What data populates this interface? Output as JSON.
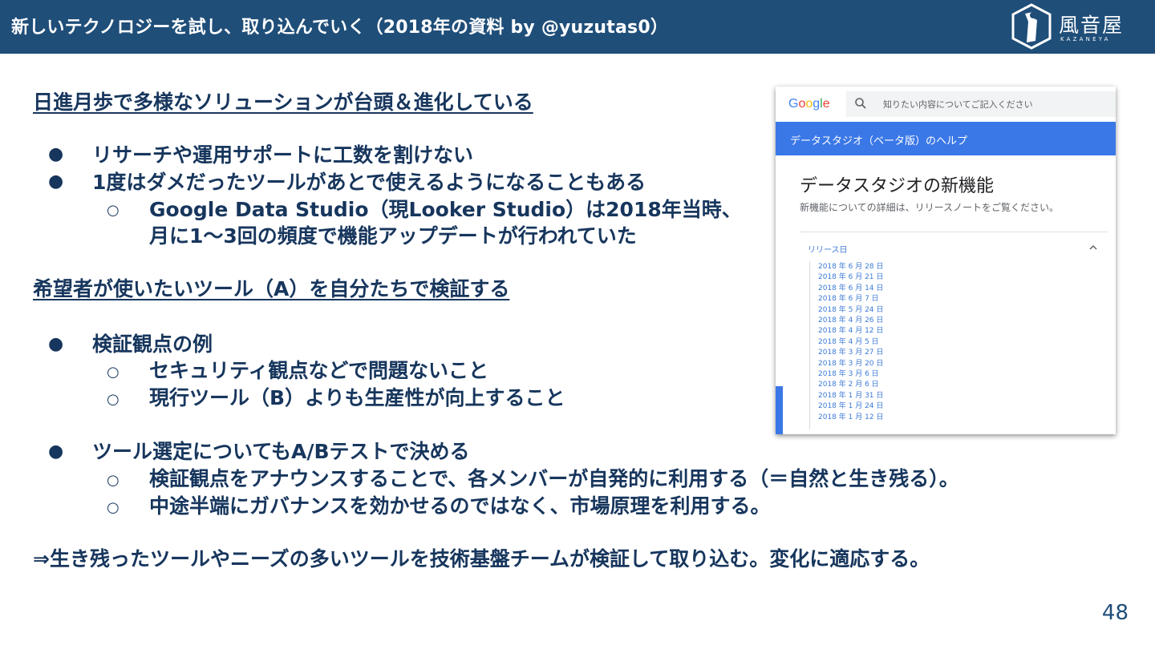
{
  "header": {
    "title": "新しいテクノロジーを試し、取り込んでいく（2018年の資料 by @yuzutas0）",
    "logo_name": "風音屋",
    "logo_sub": "KAZANEYA"
  },
  "colors": {
    "header_bg": "#1f4e79",
    "text": "#17365d",
    "google_blue": "#3b78e7"
  },
  "sections": [
    {
      "heading": "日進月歩で多様なソリューションが台頭＆進化している"
    },
    {
      "heading": "希望者が使いたいツール（A）を自分たちで検証する"
    }
  ],
  "bullets": {
    "b1": "リサーチや運用サポートに工数を割けない",
    "b2": "1度はダメだったツールがあとで使えるようになることもある",
    "b2_sub1_line1": "Google Data Studio（現Looker Studio）は2018年当時、",
    "b2_sub1_line2": "月に1〜3回の頻度で機能アップデートが行われていた",
    "b3": "検証観点の例",
    "b3_sub1": "セキュリティ観点などで問題ないこと",
    "b3_sub2": "現行ツール（B）よりも生産性が向上すること",
    "b4": "ツール選定についてもA/Bテストで決める",
    "b4_sub1": "検証観点をアナウンスすることで、各メンバーが自発的に利用する（＝自然と生き残る）。",
    "b4_sub2": "中途半端にガバナンスを効かせるのではなく、市場原理を利用する。"
  },
  "conclusion": "⇒生き残ったツールやニーズの多いツールを技術基盤チームが検証して取り込む。変化に適応する。",
  "page_number": "48",
  "screenshot": {
    "google_logo": [
      "G",
      "o",
      "o",
      "g",
      "l",
      "e"
    ],
    "search_placeholder": "知りたい内容についてご記入ください",
    "help_bar": "データスタジオ（ベータ版）のヘルプ",
    "title": "データスタジオの新機能",
    "description": "新機能についての詳細は、リリースノートをご覧ください。",
    "accordion_label": "リリース日",
    "release_dates": [
      "2018 年 6 月 28 日",
      "2018 年 6 月 21 日",
      "2018 年 6 月 14 日",
      "2018 年 6 月 7 日",
      "2018 年 5 月 24 日",
      "2018 年 4 月 26 日",
      "2018 年 4 月 12 日",
      "2018 年 4 月 5 日",
      "2018 年 3 月 27 日",
      "2018 年 3 月 20 日",
      "2018 年 3 月 6 日",
      "2018 年 2 月 6 日",
      "2018 年 1 月 31 日",
      "2018 年 1 月 24 日",
      "2018 年 1 月 12 日"
    ]
  }
}
